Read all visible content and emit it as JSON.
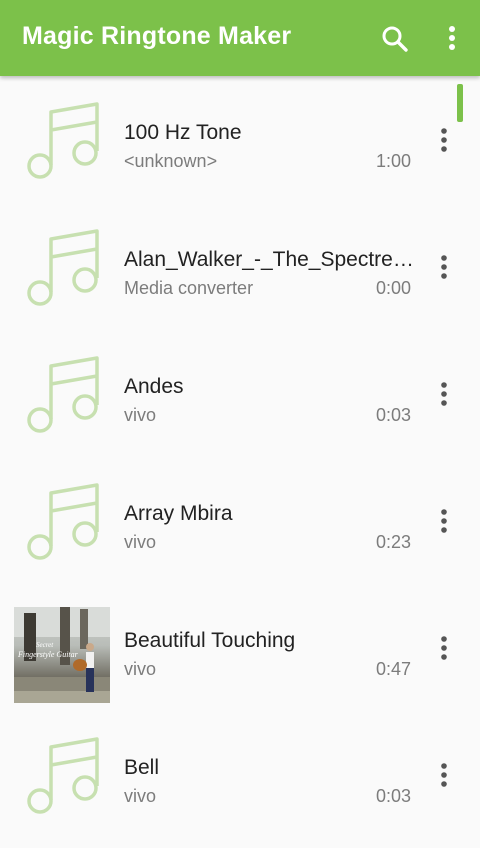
{
  "app": {
    "title": "Magic Ringtone Maker"
  },
  "icons": {
    "search": "search-icon",
    "overflow": "more-vert-icon",
    "note": "music-note-icon"
  },
  "colors": {
    "accent": "#7cc14a",
    "note_tint": "#c7e0b0"
  },
  "songs": [
    {
      "name": "100 Hz Tone",
      "artist": "<unknown>",
      "duration": "1:00"
    },
    {
      "name": "Alan_Walker_-_The_Spectre_h...",
      "artist": "Media converter",
      "duration": "0:00"
    },
    {
      "name": "Andes",
      "artist": "vivo",
      "duration": "0:03"
    },
    {
      "name": "Array Mbira",
      "artist": "vivo",
      "duration": "0:23"
    },
    {
      "name": "Beautiful Touching",
      "artist": "vivo",
      "duration": "0:47",
      "cover_text": [
        "Secret",
        "Fingerstyle Guitar"
      ]
    },
    {
      "name": "Bell",
      "artist": "vivo",
      "duration": "0:03"
    }
  ]
}
